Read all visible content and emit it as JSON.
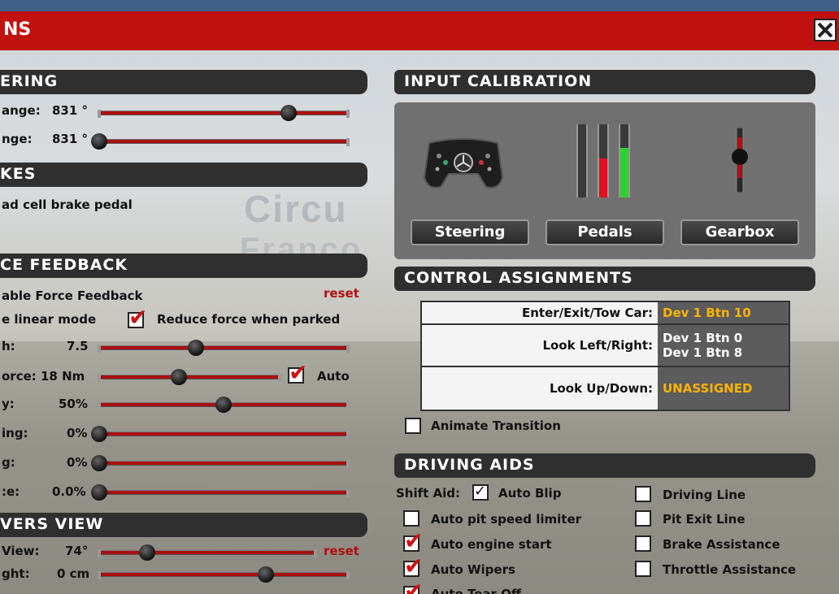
{
  "window": {
    "title": "NS",
    "close_label": "X"
  },
  "left": {
    "steering": {
      "header": "ERING",
      "rows": [
        {
          "label": "ange:",
          "value": "831 °",
          "fraction": 0.76
        },
        {
          "label": "nge:",
          "value": "831 °",
          "fraction": 0.0
        }
      ]
    },
    "brakes": {
      "header": "KES",
      "load_cell": "ad cell brake pedal"
    },
    "force_feedback": {
      "header": "CE FEEDBACK",
      "enable_label": "able Force Feedback",
      "reset": "reset",
      "linear_mode": "e linear mode",
      "reduce_force": "Reduce force when parked",
      "reduce_force_checked": true,
      "rows": [
        {
          "label": "h:",
          "value": "7.5",
          "fraction": 0.39
        },
        {
          "label": "orce: 18 Nm",
          "value": "",
          "fraction": 0.44
        },
        {
          "label": "y:",
          "value": "50%",
          "fraction": 0.5
        },
        {
          "label": "ing:",
          "value": "0%",
          "fraction": 0.0
        },
        {
          "label": "g:",
          "value": "0%",
          "fraction": 0.0
        },
        {
          "label": ":e:",
          "value": "0.0%",
          "fraction": 0.0
        }
      ],
      "auto_label": "Auto",
      "auto_checked": true
    },
    "drivers_view": {
      "header": "VERS VIEW",
      "rows": [
        {
          "label": "View:",
          "value": "74°",
          "fraction": 0.22,
          "reset": "reset"
        },
        {
          "label": "ght:",
          "value": "0 cm",
          "fraction": 0.67
        }
      ]
    }
  },
  "right": {
    "input_calibration": {
      "header": "INPUT CALIBRATION",
      "buttons": [
        "Steering",
        "Pedals",
        "Gearbox"
      ],
      "pedal_levels": [
        0.0,
        0.53,
        0.68
      ]
    },
    "control_assignments": {
      "header": "CONTROL ASSIGNMENTS",
      "rows": [
        {
          "label": "Enter/Exit/Tow Car:",
          "values": [
            "Dev 1 Btn 10"
          ],
          "orange": true
        },
        {
          "label": "Look Left/Right:",
          "values": [
            "Dev 1 Btn 0",
            "Dev 1 Btn 8"
          ],
          "orange": false
        },
        {
          "label": "Look Up/Down:",
          "values": [
            "UNASSIGNED"
          ],
          "orange": true
        }
      ],
      "animate_transition": "Animate Transition",
      "animate_checked": false
    },
    "driving_aids": {
      "header": "DRIVING AIDS",
      "shift_aid": "Shift Aid:",
      "auto_blip": "Auto Blip",
      "auto_blip_checked": true,
      "left_items": [
        {
          "label": "Auto pit speed limiter",
          "checked": false
        },
        {
          "label": "Auto engine start",
          "checked": true
        },
        {
          "label": "Auto Wipers",
          "checked": true
        },
        {
          "label": "Auto Tear Off",
          "checked": true
        }
      ],
      "right_items": [
        {
          "label": "Driving Line",
          "checked": false
        },
        {
          "label": "Pit Exit Line",
          "checked": false
        },
        {
          "label": "Brake Assistance",
          "checked": false
        },
        {
          "label": "Throttle Assistance",
          "checked": false
        }
      ]
    }
  },
  "background": {
    "watermark1": "Circu",
    "watermark2": "Franco"
  }
}
